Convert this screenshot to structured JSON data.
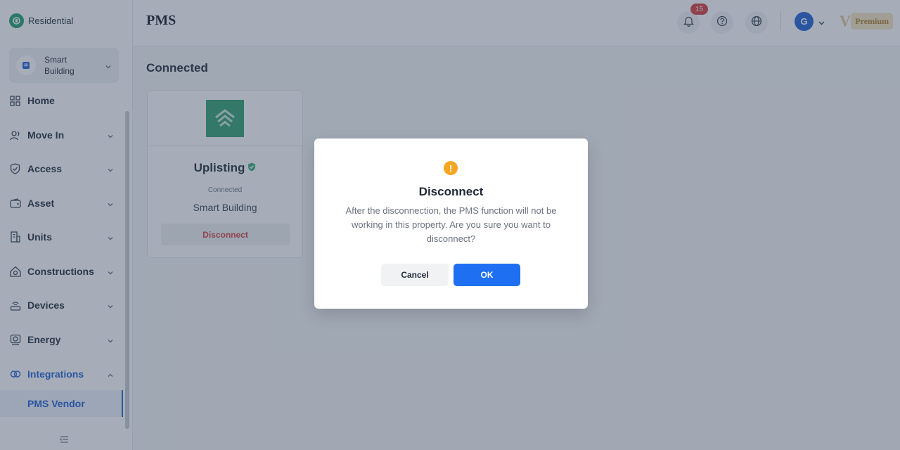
{
  "app": {
    "name": "Residential",
    "logo_icon": "residential-logo-icon"
  },
  "sidebar": {
    "property_selector": {
      "label": "Smart Building",
      "icon": "building-icon"
    },
    "items": [
      {
        "label": "Home",
        "icon": "grid-icon"
      },
      {
        "label": "Move In",
        "icon": "users-icon"
      },
      {
        "label": "Access",
        "icon": "shield-icon"
      },
      {
        "label": "Asset",
        "icon": "wallet-icon"
      },
      {
        "label": "Units",
        "icon": "building-icon"
      },
      {
        "label": "Constructions",
        "icon": "construction-icon"
      },
      {
        "label": "Devices",
        "icon": "router-icon"
      },
      {
        "label": "Energy",
        "icon": "energy-icon"
      },
      {
        "label": "Integrations",
        "icon": "link-icon"
      }
    ],
    "active_sub_item": "PMS Vendor"
  },
  "header": {
    "title": "PMS",
    "notification_count": "15",
    "avatar_initial": "G",
    "premium_label": "Premium",
    "premium_logo_letter": "V"
  },
  "main": {
    "section_title": "Connected",
    "card": {
      "name": "Uplisting",
      "status": "Connected",
      "property": "Smart Building",
      "action": "Disconnect"
    }
  },
  "modal": {
    "title": "Disconnect",
    "message": "After the disconnection, the PMS function will not be working in this property. Are you sure you want to disconnect?",
    "cancel_label": "Cancel",
    "ok_label": "OK",
    "warning_glyph": "!"
  },
  "colors": {
    "accent": "#1f6ff2",
    "danger": "#d63b3b",
    "brand_green": "#2f9e6f",
    "warning": "#f5a623"
  }
}
